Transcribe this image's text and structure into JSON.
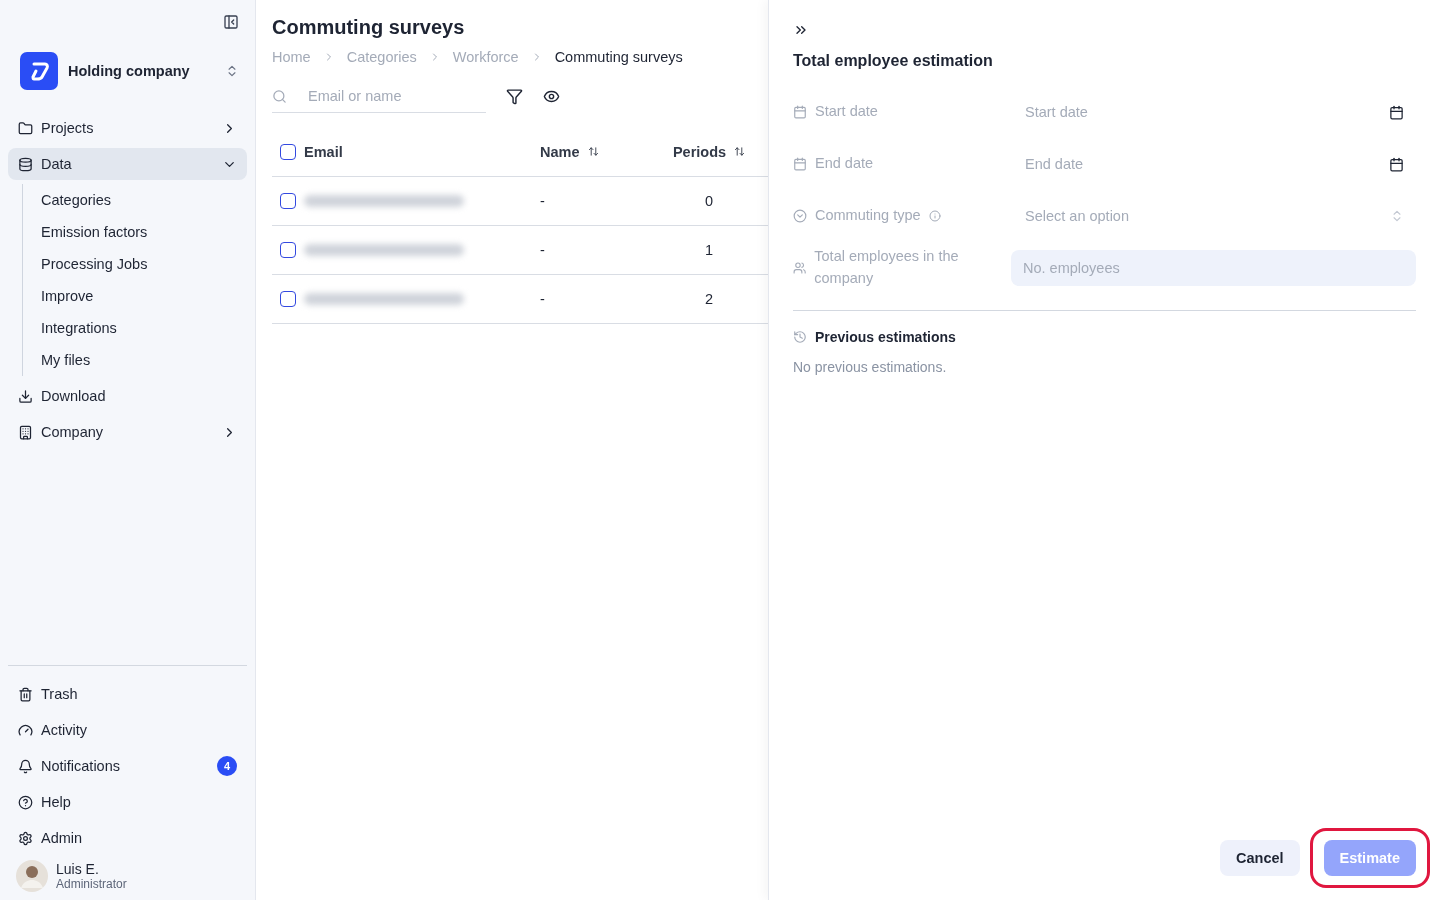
{
  "sidebar": {
    "company": "Holding company",
    "nav": [
      {
        "kind": "group",
        "label": "Projects",
        "expanded": false,
        "selected": false
      },
      {
        "kind": "group",
        "label": "Data",
        "expanded": true,
        "selected": true,
        "children": [
          {
            "label": "Categories"
          },
          {
            "label": "Emission factors"
          },
          {
            "label": "Processing Jobs"
          },
          {
            "label": "Improve"
          },
          {
            "label": "Integrations"
          },
          {
            "label": "My files"
          }
        ]
      },
      {
        "kind": "download",
        "label": "Download"
      },
      {
        "kind": "company",
        "label": "Company",
        "expanded": false,
        "selected": false
      }
    ],
    "footer": [
      {
        "kind": "trash",
        "label": "Trash"
      },
      {
        "kind": "activity",
        "label": "Activity"
      },
      {
        "kind": "notifications",
        "label": "Notifications",
        "badge": "4"
      },
      {
        "kind": "help",
        "label": "Help"
      },
      {
        "kind": "admin",
        "label": "Admin"
      }
    ],
    "user": {
      "name": "Luis E.",
      "role": "Administrator"
    }
  },
  "main": {
    "title": "Commuting surveys",
    "breadcrumbs": [
      {
        "label": "Home",
        "current": false
      },
      {
        "label": "Categories",
        "current": false
      },
      {
        "label": "Workforce",
        "current": false
      },
      {
        "label": "Commuting surveys",
        "current": true
      }
    ],
    "search": {
      "placeholder": "Email or name"
    },
    "table": {
      "all_checked": false,
      "columns": [
        {
          "label": "Email",
          "sortable": false
        },
        {
          "label": "Name",
          "sortable": true
        },
        {
          "label": "Periods",
          "sortable": true
        }
      ],
      "rows": [
        {
          "checked": false,
          "name": "-",
          "periods": "0"
        },
        {
          "checked": false,
          "name": "-",
          "periods": "1"
        },
        {
          "checked": false,
          "name": "-",
          "periods": "2"
        }
      ]
    }
  },
  "panel": {
    "title": "Total employee estimation",
    "fields": [
      {
        "kind": "date",
        "label": "Start date",
        "placeholder": "Start date"
      },
      {
        "kind": "date",
        "label": "End date",
        "placeholder": "End date"
      },
      {
        "kind": "select",
        "label": "Commuting type",
        "info": true,
        "placeholder": "Select an option"
      },
      {
        "kind": "number",
        "label": "Total employees in the company",
        "placeholder": "No. employees"
      }
    ],
    "history": {
      "title": "Previous estimations",
      "empty": "No previous estimations."
    },
    "buttons": [
      {
        "kind": "cancel",
        "label": "Cancel",
        "disabled": false
      },
      {
        "kind": "primary",
        "label": "Estimate",
        "disabled": true,
        "highlighted": true
      }
    ]
  }
}
